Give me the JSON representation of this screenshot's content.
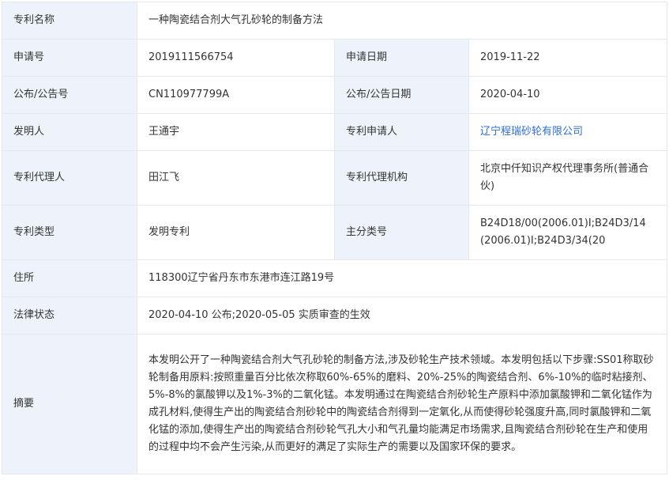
{
  "rows": {
    "title": {
      "label": "专利名称",
      "value": "一种陶瓷结合剂大气孔砂轮的制备方法"
    },
    "app_no": {
      "label": "申请号",
      "value": "2019111566754"
    },
    "app_date": {
      "label": "申请日期",
      "value": "2019-11-22"
    },
    "pub_no": {
      "label": "公布/公告号",
      "value": "CN110977799A"
    },
    "pub_date": {
      "label": "公布/公告日期",
      "value": "2020-04-10"
    },
    "inventor": {
      "label": "发明人",
      "value": "王通宇"
    },
    "applicant": {
      "label": "专利申请人",
      "value": "辽宁程瑞砂轮有限公司"
    },
    "agent": {
      "label": "专利代理人",
      "value": "田江飞"
    },
    "agency": {
      "label": "专利代理机构",
      "value": "北京中仟知识产权代理事务所(普通合伙)"
    },
    "type": {
      "label": "专利类型",
      "value": "发明专利"
    },
    "ipc": {
      "label": "主分类号",
      "value": "B24D18/00(2006.01)I;B24D3/14(2006.01)I;B24D3/34(20"
    },
    "address": {
      "label": "住所",
      "value": "118300辽宁省丹东市东港市连江路19号"
    },
    "legal": {
      "label": "法律状态",
      "value": "2020-04-10 公布;2020-05-05 实质审查的生效"
    },
    "abstract": {
      "label": "摘要",
      "value": "本发明公开了一种陶瓷结合剂大气孔砂轮的制备方法,涉及砂轮生产技术领域。本发明包括以下步骤:SS01称取砂轮制备用原料:按照重量百分比依次称取60%-65%的磨料、20%-25%的陶瓷结合剂、6%-10%的临时粘接剂、5%-8%的氯酸钾以及1%-3%的二氧化锰。本发明通过在陶瓷结合剂砂轮生产原料中添加氯酸钾和二氧化锰作为成孔材料,使得生产出的陶瓷结合剂砂轮中的陶瓷结合剂得到一定氧化,从而使得砂轮强度升高,同时氯酸钾和二氧化锰的添加,使得生产出的陶瓷结合剂砂轮气孔大小和气孔量均能满足市场需求,且陶瓷结合剂砂轮在生产和使用的过程中均不会产生污染,从而更好的满足了实际生产的需要以及国家环保的要求。"
    }
  },
  "colors": {
    "label_bg": "#eef3fb",
    "border": "#e4e8ef",
    "link": "#2f6fd6"
  }
}
